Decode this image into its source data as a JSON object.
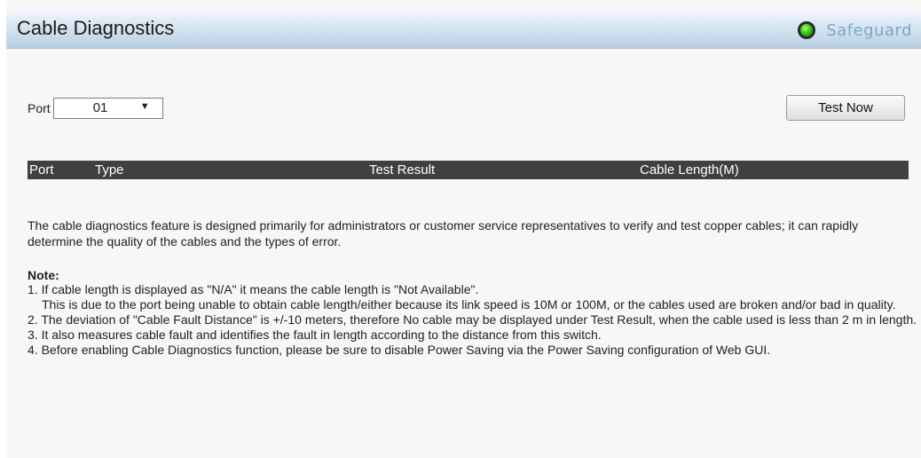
{
  "header": {
    "title": "Cable Diagnostics",
    "safeguard_label": "Safeguard",
    "safeguard_status_color": "#3ec21b"
  },
  "port_select": {
    "label": "Port",
    "selected": "01"
  },
  "test_button": {
    "label": "Test Now"
  },
  "table": {
    "columns": [
      "Port",
      "Type",
      "Test Result",
      "Cable Length(M)"
    ],
    "rows": []
  },
  "description": "The cable diagnostics feature is designed primarily for administrators or customer service representatives to verify and test copper cables; it can rapidly determine the quality of the cables and the types of error.",
  "note": {
    "title": "Note:",
    "items": [
      "1. If cable length is displayed as \"N/A\" it means the cable length is \"Not Available\".",
      "This is due to the port being unable to obtain cable length/either because its link speed is 10M or 100M, or the cables used are broken and/or bad in quality.",
      "2. The deviation of \"Cable Fault Distance\" is +/-10 meters, therefore No cable may be displayed under Test Result, when the cable used is less than 2 m in length.",
      "3. It also measures cable fault and identifies the fault in length according to the distance from this switch.",
      "4. Before enabling Cable Diagnostics function, please be sure to disable Power Saving via the Power Saving configuration of Web GUI."
    ]
  }
}
